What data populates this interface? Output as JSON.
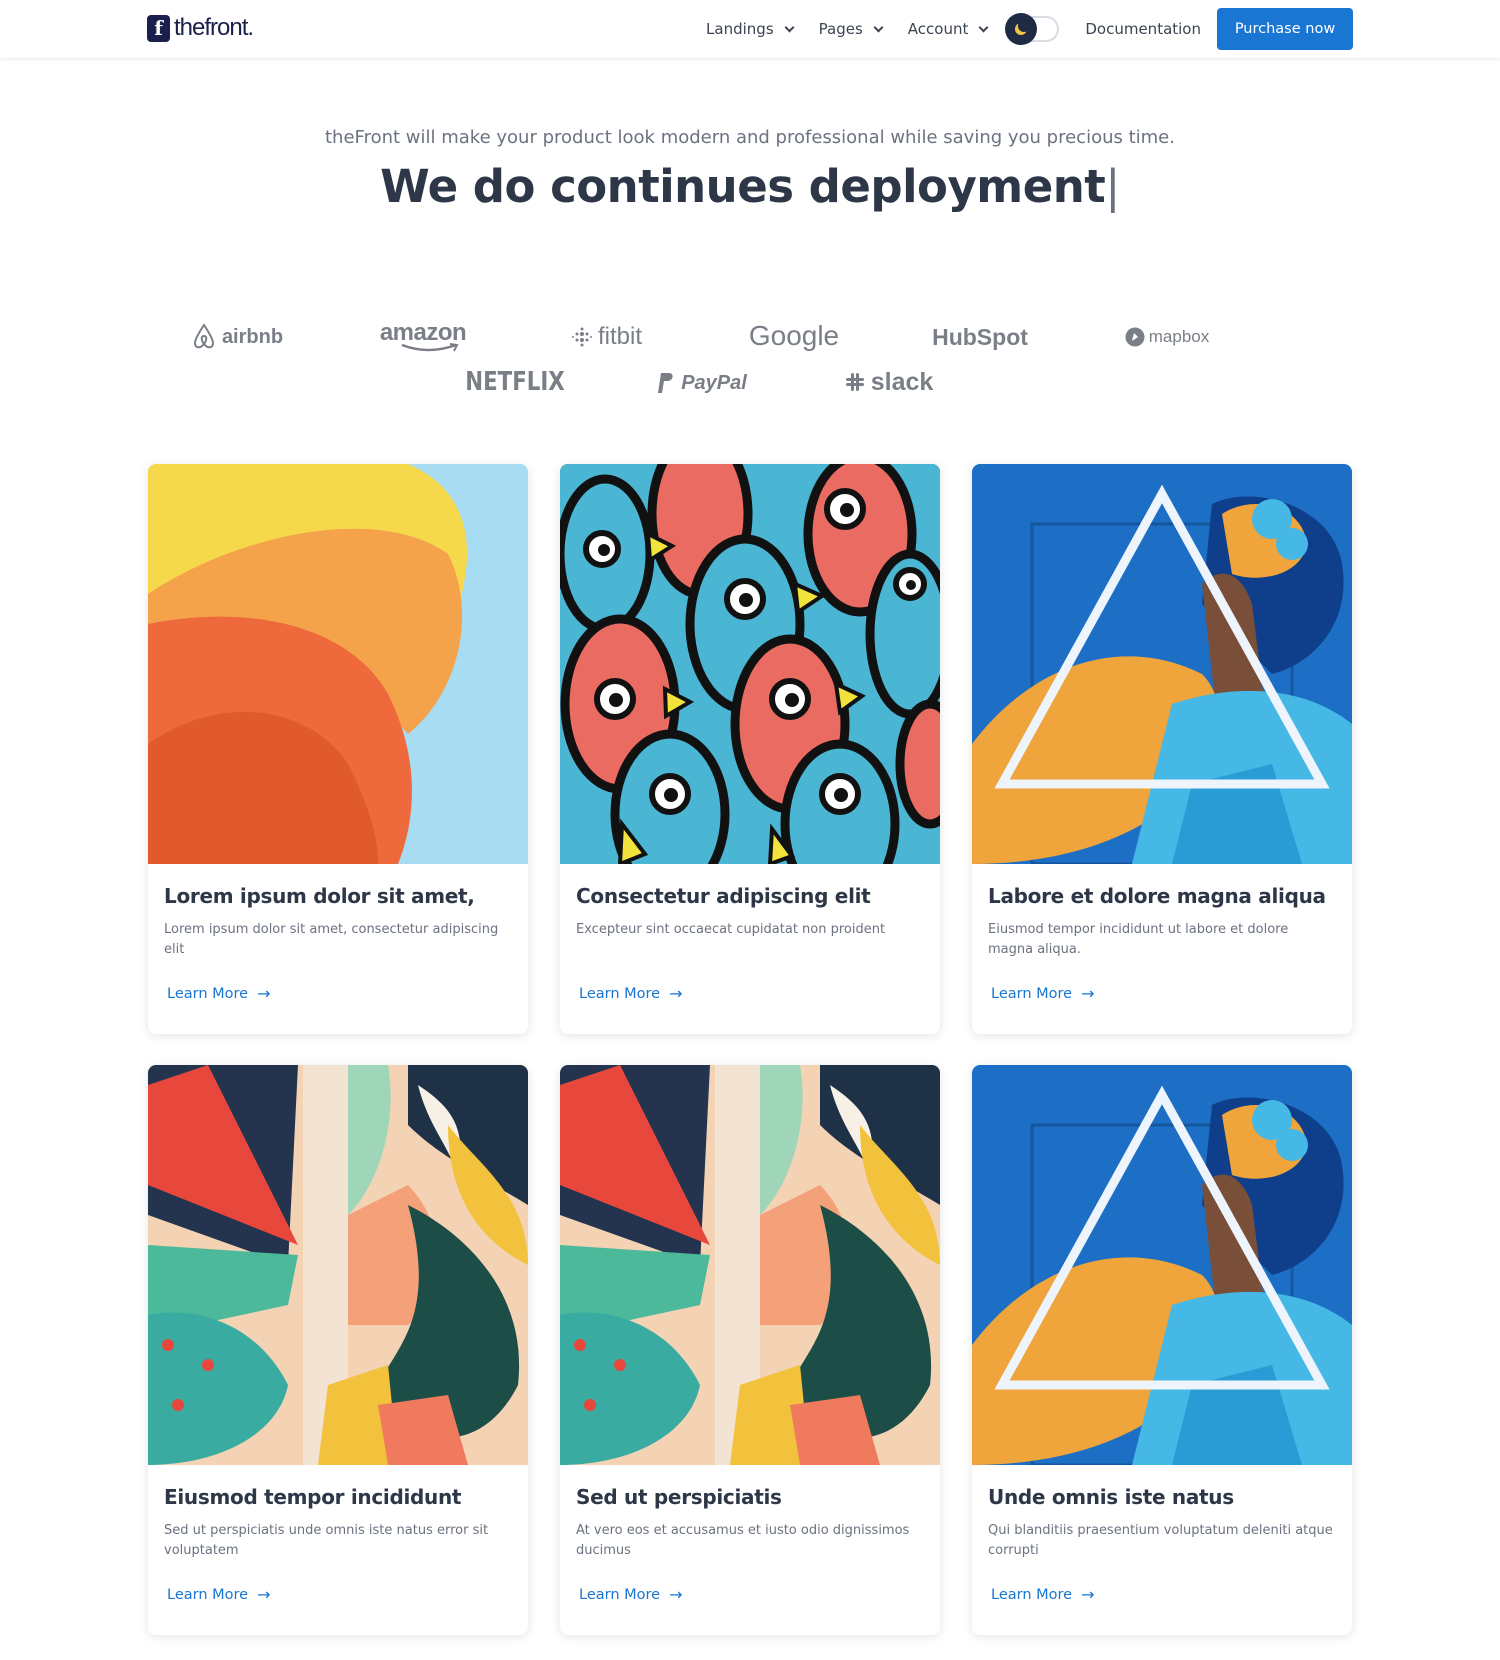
{
  "header": {
    "logo_text": "thefront.",
    "logo_mark": "f",
    "nav": [
      {
        "label": "Landings"
      },
      {
        "label": "Pages"
      },
      {
        "label": "Account"
      }
    ],
    "documentation_label": "Documentation",
    "purchase_label": "Purchase now",
    "accent_color": "#1976d2"
  },
  "hero": {
    "subtitle": "theFront will make your product look modern and professional while saving you precious time.",
    "title": "We do continues deployment",
    "cursor": "|"
  },
  "brands": [
    "airbnb",
    "amazon",
    "fitbit",
    "Google",
    "HubSpot",
    "mapbox",
    "NETFLIX",
    "PayPal",
    "slack"
  ],
  "cards": [
    {
      "title": "Lorem ipsum dolor sit amet,",
      "description": "Lorem ipsum dolor sit amet, consectetur adipiscing elit",
      "link": "Learn More"
    },
    {
      "title": "Consectetur adipiscing elit",
      "description": "Excepteur sint occaecat cupidatat non proident",
      "link": "Learn More"
    },
    {
      "title": "Labore et dolore magna aliqua",
      "description": "Eiusmod tempor incididunt ut labore et dolore magna aliqua.",
      "link": "Learn More"
    },
    {
      "title": "Eiusmod tempor incididunt",
      "description": "Sed ut perspiciatis unde omnis iste natus error sit voluptatem",
      "link": "Learn More"
    },
    {
      "title": "Sed ut perspiciatis",
      "description": "At vero eos et accusamus et iusto odio dignissimos ducimus",
      "link": "Learn More"
    },
    {
      "title": "Unde omnis iste natus",
      "description": "Qui blanditiis praesentium voluptatum deleniti atque corrupti",
      "link": "Learn More"
    }
  ]
}
